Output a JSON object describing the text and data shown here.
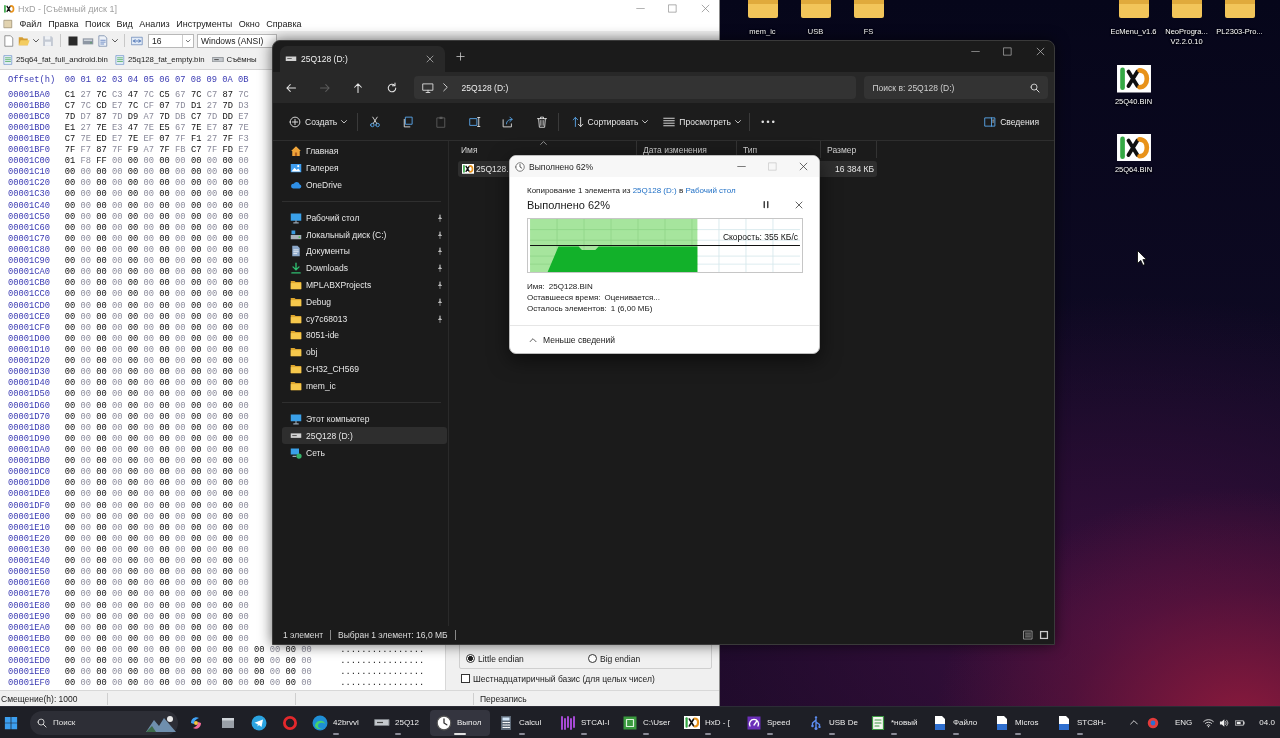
{
  "hxd": {
    "title": "HxD - [Съёмный диск 1]",
    "menu": [
      "Файл",
      "Правка",
      "Поиск",
      "Вид",
      "Анализ",
      "Инструменты",
      "Окно",
      "Справка"
    ],
    "toolbar": {
      "bytes_per_row": "16",
      "encoding": "Windows (ANSI)"
    },
    "tabs": [
      {
        "kind": "file",
        "label": "25q64_fat_full_android.bin"
      },
      {
        "kind": "file",
        "label": "25q128_fat_empty.bin"
      },
      {
        "kind": "drive",
        "label": "Съёмны"
      }
    ],
    "hex_header": {
      "offset_label": "Offset(h)",
      "columns": [
        "00",
        "01",
        "02",
        "03",
        "04",
        "05",
        "06",
        "07",
        "08",
        "09",
        "0A",
        "0B"
      ]
    },
    "hex_rows": [
      {
        "offset": "00001BA0",
        "bytes": [
          "C1",
          "27",
          "7C",
          "C3",
          "47",
          "7C",
          "C5",
          "67",
          "7C",
          "C7",
          "87",
          "7C"
        ]
      },
      {
        "offset": "00001BB0",
        "bytes": [
          "C7",
          "7C",
          "CD",
          "E7",
          "7C",
          "CF",
          "07",
          "7D",
          "D1",
          "27",
          "7D",
          "D3"
        ]
      },
      {
        "offset": "00001BC0",
        "bytes": [
          "7D",
          "D7",
          "87",
          "7D",
          "D9",
          "A7",
          "7D",
          "DB",
          "C7",
          "7D",
          "DD",
          "E7"
        ]
      },
      {
        "offset": "00001BD0",
        "bytes": [
          "E1",
          "27",
          "7E",
          "E3",
          "47",
          "7E",
          "E5",
          "67",
          "7E",
          "E7",
          "87",
          "7E"
        ]
      },
      {
        "offset": "00001BE0",
        "bytes": [
          "C7",
          "7E",
          "ED",
          "E7",
          "7E",
          "EF",
          "07",
          "7F",
          "F1",
          "27",
          "7F",
          "F3"
        ]
      },
      {
        "offset": "00001BF0",
        "bytes": [
          "7F",
          "F7",
          "87",
          "7F",
          "F9",
          "A7",
          "7F",
          "FB",
          "C7",
          "7F",
          "FD",
          "E7"
        ]
      },
      {
        "offset": "00001C00",
        "bytes": [
          "01",
          "F8",
          "FF",
          "00",
          "00",
          "00",
          "00",
          "00",
          "00",
          "00",
          "00",
          "00"
        ]
      },
      {
        "offset": "00001C10",
        "bytes": [
          "00",
          "00",
          "00",
          "00",
          "00",
          "00",
          "00",
          "00",
          "00",
          "00",
          "00",
          "00"
        ]
      },
      {
        "offset": "00001C20",
        "bytes": [
          "00",
          "00",
          "00",
          "00",
          "00",
          "00",
          "00",
          "00",
          "00",
          "00",
          "00",
          "00"
        ]
      },
      {
        "offset": "00001C30",
        "bytes": [
          "00",
          "00",
          "00",
          "00",
          "00",
          "00",
          "00",
          "00",
          "00",
          "00",
          "00",
          "00"
        ]
      },
      {
        "offset": "00001C40",
        "bytes": [
          "00",
          "00",
          "00",
          "00",
          "00",
          "00",
          "00",
          "00",
          "00",
          "00",
          "00",
          "00"
        ]
      },
      {
        "offset": "00001C50",
        "bytes": [
          "00",
          "00",
          "00",
          "00",
          "00",
          "00",
          "00",
          "00",
          "00",
          "00",
          "00",
          "00"
        ]
      },
      {
        "offset": "00001C60",
        "bytes": [
          "00",
          "00",
          "00",
          "00",
          "00",
          "00",
          "00",
          "00",
          "00",
          "00",
          "00",
          "00"
        ]
      },
      {
        "offset": "00001C70",
        "bytes": [
          "00",
          "00",
          "00",
          "00",
          "00",
          "00",
          "00",
          "00",
          "00",
          "00",
          "00",
          "00"
        ]
      },
      {
        "offset": "00001C80",
        "bytes": [
          "00",
          "00",
          "00",
          "00",
          "00",
          "00",
          "00",
          "00",
          "00",
          "00",
          "00",
          "00"
        ]
      },
      {
        "offset": "00001C90",
        "bytes": [
          "00",
          "00",
          "00",
          "00",
          "00",
          "00",
          "00",
          "00",
          "00",
          "00",
          "00",
          "00"
        ]
      },
      {
        "offset": "00001CA0",
        "bytes": [
          "00",
          "00",
          "00",
          "00",
          "00",
          "00",
          "00",
          "00",
          "00",
          "00",
          "00",
          "00"
        ]
      },
      {
        "offset": "00001CB0",
        "bytes": [
          "00",
          "00",
          "00",
          "00",
          "00",
          "00",
          "00",
          "00",
          "00",
          "00",
          "00",
          "00"
        ]
      },
      {
        "offset": "00001CC0",
        "bytes": [
          "00",
          "00",
          "00",
          "00",
          "00",
          "00",
          "00",
          "00",
          "00",
          "00",
          "00",
          "00"
        ]
      },
      {
        "offset": "00001CD0",
        "bytes": [
          "00",
          "00",
          "00",
          "00",
          "00",
          "00",
          "00",
          "00",
          "00",
          "00",
          "00",
          "00"
        ]
      },
      {
        "offset": "00001CE0",
        "bytes": [
          "00",
          "00",
          "00",
          "00",
          "00",
          "00",
          "00",
          "00",
          "00",
          "00",
          "00",
          "00"
        ]
      },
      {
        "offset": "00001CF0",
        "bytes": [
          "00",
          "00",
          "00",
          "00",
          "00",
          "00",
          "00",
          "00",
          "00",
          "00",
          "00",
          "00"
        ]
      },
      {
        "offset": "00001D00",
        "bytes": [
          "00",
          "00",
          "00",
          "00",
          "00",
          "00",
          "00",
          "00",
          "00",
          "00",
          "00",
          "00"
        ]
      },
      {
        "offset": "00001D10",
        "bytes": [
          "00",
          "00",
          "00",
          "00",
          "00",
          "00",
          "00",
          "00",
          "00",
          "00",
          "00",
          "00"
        ]
      },
      {
        "offset": "00001D20",
        "bytes": [
          "00",
          "00",
          "00",
          "00",
          "00",
          "00",
          "00",
          "00",
          "00",
          "00",
          "00",
          "00"
        ]
      },
      {
        "offset": "00001D30",
        "bytes": [
          "00",
          "00",
          "00",
          "00",
          "00",
          "00",
          "00",
          "00",
          "00",
          "00",
          "00",
          "00"
        ]
      },
      {
        "offset": "00001D40",
        "bytes": [
          "00",
          "00",
          "00",
          "00",
          "00",
          "00",
          "00",
          "00",
          "00",
          "00",
          "00",
          "00"
        ]
      },
      {
        "offset": "00001D50",
        "bytes": [
          "00",
          "00",
          "00",
          "00",
          "00",
          "00",
          "00",
          "00",
          "00",
          "00",
          "00",
          "00"
        ]
      },
      {
        "offset": "00001D60",
        "bytes": [
          "00",
          "00",
          "00",
          "00",
          "00",
          "00",
          "00",
          "00",
          "00",
          "00",
          "00",
          "00"
        ]
      },
      {
        "offset": "00001D70",
        "bytes": [
          "00",
          "00",
          "00",
          "00",
          "00",
          "00",
          "00",
          "00",
          "00",
          "00",
          "00",
          "00"
        ]
      },
      {
        "offset": "00001D80",
        "bytes": [
          "00",
          "00",
          "00",
          "00",
          "00",
          "00",
          "00",
          "00",
          "00",
          "00",
          "00",
          "00"
        ]
      },
      {
        "offset": "00001D90",
        "bytes": [
          "00",
          "00",
          "00",
          "00",
          "00",
          "00",
          "00",
          "00",
          "00",
          "00",
          "00",
          "00"
        ]
      },
      {
        "offset": "00001DA0",
        "bytes": [
          "00",
          "00",
          "00",
          "00",
          "00",
          "00",
          "00",
          "00",
          "00",
          "00",
          "00",
          "00"
        ]
      },
      {
        "offset": "00001DB0",
        "bytes": [
          "00",
          "00",
          "00",
          "00",
          "00",
          "00",
          "00",
          "00",
          "00",
          "00",
          "00",
          "00"
        ]
      },
      {
        "offset": "00001DC0",
        "bytes": [
          "00",
          "00",
          "00",
          "00",
          "00",
          "00",
          "00",
          "00",
          "00",
          "00",
          "00",
          "00"
        ]
      },
      {
        "offset": "00001DD0",
        "bytes": [
          "00",
          "00",
          "00",
          "00",
          "00",
          "00",
          "00",
          "00",
          "00",
          "00",
          "00",
          "00"
        ]
      },
      {
        "offset": "00001DE0",
        "bytes": [
          "00",
          "00",
          "00",
          "00",
          "00",
          "00",
          "00",
          "00",
          "00",
          "00",
          "00",
          "00"
        ]
      },
      {
        "offset": "00001DF0",
        "bytes": [
          "00",
          "00",
          "00",
          "00",
          "00",
          "00",
          "00",
          "00",
          "00",
          "00",
          "00",
          "00"
        ]
      },
      {
        "offset": "00001E00",
        "bytes": [
          "00",
          "00",
          "00",
          "00",
          "00",
          "00",
          "00",
          "00",
          "00",
          "00",
          "00",
          "00"
        ]
      },
      {
        "offset": "00001E10",
        "bytes": [
          "00",
          "00",
          "00",
          "00",
          "00",
          "00",
          "00",
          "00",
          "00",
          "00",
          "00",
          "00"
        ]
      },
      {
        "offset": "00001E20",
        "bytes": [
          "00",
          "00",
          "00",
          "00",
          "00",
          "00",
          "00",
          "00",
          "00",
          "00",
          "00",
          "00"
        ]
      },
      {
        "offset": "00001E30",
        "bytes": [
          "00",
          "00",
          "00",
          "00",
          "00",
          "00",
          "00",
          "00",
          "00",
          "00",
          "00",
          "00"
        ]
      },
      {
        "offset": "00001E40",
        "bytes": [
          "00",
          "00",
          "00",
          "00",
          "00",
          "00",
          "00",
          "00",
          "00",
          "00",
          "00",
          "00"
        ]
      },
      {
        "offset": "00001E50",
        "bytes": [
          "00",
          "00",
          "00",
          "00",
          "00",
          "00",
          "00",
          "00",
          "00",
          "00",
          "00",
          "00"
        ]
      },
      {
        "offset": "00001E60",
        "bytes": [
          "00",
          "00",
          "00",
          "00",
          "00",
          "00",
          "00",
          "00",
          "00",
          "00",
          "00",
          "00"
        ]
      },
      {
        "offset": "00001E70",
        "bytes": [
          "00",
          "00",
          "00",
          "00",
          "00",
          "00",
          "00",
          "00",
          "00",
          "00",
          "00",
          "00"
        ]
      },
      {
        "offset": "00001E80",
        "bytes": [
          "00",
          "00",
          "00",
          "00",
          "00",
          "00",
          "00",
          "00",
          "00",
          "00",
          "00",
          "00"
        ]
      },
      {
        "offset": "00001E90",
        "bytes": [
          "00",
          "00",
          "00",
          "00",
          "00",
          "00",
          "00",
          "00",
          "00",
          "00",
          "00",
          "00"
        ]
      },
      {
        "offset": "00001EA0",
        "bytes": [
          "00",
          "00",
          "00",
          "00",
          "00",
          "00",
          "00",
          "00",
          "00",
          "00",
          "00",
          "00"
        ]
      },
      {
        "offset": "00001EB0",
        "bytes": [
          "00",
          "00",
          "00",
          "00",
          "00",
          "00",
          "00",
          "00",
          "00",
          "00",
          "00",
          "00"
        ]
      },
      {
        "offset": "00001EC0",
        "bytes": [
          "00",
          "00",
          "00",
          "00",
          "00",
          "00",
          "00",
          "00",
          "00",
          "00",
          "00",
          "00",
          "00",
          "00",
          "00",
          "00"
        ],
        "ascii": "................"
      },
      {
        "offset": "00001ED0",
        "bytes": [
          "00",
          "00",
          "00",
          "00",
          "00",
          "00",
          "00",
          "00",
          "00",
          "00",
          "00",
          "00",
          "00",
          "00",
          "00",
          "00"
        ],
        "ascii": "................"
      },
      {
        "offset": "00001EE0",
        "bytes": [
          "00",
          "00",
          "00",
          "00",
          "00",
          "00",
          "00",
          "00",
          "00",
          "00",
          "00",
          "00",
          "00",
          "00",
          "00",
          "00"
        ],
        "ascii": "................"
      },
      {
        "offset": "00001EF0",
        "bytes": [
          "00",
          "00",
          "00",
          "00",
          "00",
          "00",
          "00",
          "00",
          "00",
          "00",
          "00",
          "00",
          "00",
          "00",
          "00",
          "00"
        ],
        "ascii": "................"
      }
    ],
    "inspector": {
      "endian": [
        {
          "label": "Little endian",
          "selected": true
        },
        {
          "label": "Big endian",
          "selected": false
        }
      ],
      "hex_basis": {
        "label": "Шестнадцатиричный базис (для целых чисел)",
        "checked": false
      }
    },
    "status_bar": {
      "offset": "Смещение(h): 1000",
      "mode": "Перезапись"
    }
  },
  "explorer": {
    "tab": {
      "label": "25Q128 (D:)"
    },
    "nav": [
      {
        "kind": "back",
        "disabled": false
      },
      {
        "kind": "forward",
        "disabled": true
      },
      {
        "kind": "up",
        "disabled": false
      },
      {
        "kind": "refresh",
        "disabled": false
      }
    ],
    "address": {
      "path": "25Q128 (D:)"
    },
    "search": {
      "placeholder": "Поиск в: 25Q128 (D:)"
    },
    "toolbar": [
      {
        "items": [
          {
            "kind": "new",
            "label": "Создать",
            "dropdown": true,
            "disabled": false
          }
        ]
      },
      {
        "items": [
          {
            "kind": "cut",
            "dropdown": false,
            "disabled": false
          },
          {
            "kind": "copy",
            "dropdown": false,
            "disabled": false
          },
          {
            "kind": "paste",
            "dropdown": false,
            "disabled": true
          },
          {
            "kind": "rename",
            "dropdown": false,
            "disabled": false
          },
          {
            "kind": "share",
            "dropdown": false,
            "disabled": false
          },
          {
            "kind": "delete",
            "dropdown": false,
            "disabled": false
          }
        ]
      },
      {
        "items": [
          {
            "kind": "sort",
            "label": "Сортировать",
            "dropdown": true,
            "disabled": false
          },
          {
            "kind": "view",
            "label": "Просмотреть",
            "dropdown": true,
            "disabled": false
          }
        ]
      },
      {
        "items": [
          {
            "kind": "more",
            "dropdown": false,
            "disabled": false
          }
        ]
      }
    ],
    "details_button": {
      "label": "Сведения"
    },
    "sidebar": [
      {
        "items": [
          {
            "kind": "home",
            "label": "Главная",
            "pinned": false,
            "selected": false
          },
          {
            "kind": "gallery",
            "label": "Галерея",
            "pinned": false,
            "selected": false
          },
          {
            "kind": "onedrive",
            "label": "OneDrive",
            "pinned": false,
            "selected": false
          }
        ]
      },
      {
        "items": [
          {
            "kind": "desktop",
            "label": "Рабочий стол",
            "pinned": true,
            "selected": false
          },
          {
            "kind": "localdisk",
            "label": "Локальный диск (C:)",
            "pinned": true,
            "selected": false
          },
          {
            "kind": "documents",
            "label": "Документы",
            "pinned": true,
            "selected": false
          },
          {
            "kind": "downloads",
            "label": "Downloads",
            "pinned": true,
            "selected": false
          },
          {
            "kind": "folder",
            "label": "MPLABXProjects",
            "pinned": true,
            "selected": false
          },
          {
            "kind": "folder",
            "label": "Debug",
            "pinned": true,
            "selected": false
          },
          {
            "kind": "folder",
            "label": "cy7c68013",
            "pinned": true,
            "selected": false
          },
          {
            "kind": "folder",
            "label": "8051-ide",
            "pinned": false,
            "selected": false
          },
          {
            "kind": "folder",
            "label": "obj",
            "pinned": false,
            "selected": false
          },
          {
            "kind": "folder",
            "label": "CH32_CH569",
            "pinned": false,
            "selected": false
          },
          {
            "kind": "folder",
            "label": "mem_ic",
            "pinned": false,
            "selected": false
          }
        ]
      },
      {
        "items": [
          {
            "kind": "computer",
            "label": "Этот компьютер",
            "pinned": false,
            "selected": false
          },
          {
            "kind": "usbdrive",
            "label": "25Q128 (D:)",
            "pinned": false,
            "selected": true
          },
          {
            "kind": "network",
            "label": "Сеть",
            "pinned": false,
            "selected": false
          }
        ]
      }
    ],
    "columns": [
      {
        "label": "Имя",
        "sorted": true
      },
      {
        "label": "Дата изменения",
        "sorted": false
      },
      {
        "label": "Тип",
        "sorted": false
      },
      {
        "label": "Размер",
        "sorted": false
      }
    ],
    "files": [
      {
        "name": "25Q128.",
        "size": "16 384 КБ",
        "selected": true
      }
    ],
    "status": [
      "1 элемент",
      "Выбран 1 элемент: 16,0 МБ"
    ]
  },
  "copy_dialog": {
    "title": "Выполнено 62%",
    "window_controls": [
      {
        "kind": "minimize",
        "disabled": false
      },
      {
        "kind": "maximize",
        "disabled": true
      },
      {
        "kind": "close",
        "disabled": false
      }
    ],
    "summary": {
      "prefix": "Копирование 1 элемента из",
      "source": "25Q128 (D:)",
      "middle": "в",
      "destination": "Рабочий стол"
    },
    "heading": "Выполнено 62%",
    "progress": {
      "level": 0.62,
      "speed": "Скорость: 355 КБ/с"
    },
    "details": [
      {
        "label": "Имя:",
        "value": "25Q128.BIN"
      },
      {
        "label": "Оставшееся время:",
        "value": "Оценивается..."
      },
      {
        "label": "Осталось элементов:",
        "value": "1 (6,00 МБ)"
      }
    ],
    "toggle": "Меньше сведений"
  },
  "desktop": {
    "top_left": [
      {
        "label": "mem_ic"
      },
      {
        "label": "USB"
      },
      {
        "label": "FS"
      }
    ],
    "top_right": [
      {
        "label": "EcMenu_v1.6"
      },
      {
        "label": "NeoProgra... V2.2.0.10"
      },
      {
        "label": "PL2303-Pro..."
      }
    ],
    "files": [
      {
        "label": "25Q40.BIN"
      },
      {
        "label": "25Q64.BIN"
      }
    ]
  },
  "taskbar": {
    "search": {
      "placeholder": "Поиск"
    },
    "pinned": [
      {
        "kind": "swirl"
      },
      {
        "kind": "window"
      },
      {
        "kind": "plane"
      },
      {
        "kind": "ring"
      }
    ],
    "apps": [
      {
        "kind": "browser",
        "label": "42brvvl",
        "selected": false
      },
      {
        "kind": "drive",
        "label": "25Q12",
        "selected": false
      },
      {
        "kind": "clock",
        "label": "Выпол",
        "selected": true
      },
      {
        "kind": "calculator",
        "label": "Calcul",
        "selected": false
      },
      {
        "kind": "stripes",
        "label": "STCAI-I",
        "selected": false
      },
      {
        "kind": "tile",
        "label": "C:\\User",
        "selected": false
      },
      {
        "kind": "hexfile",
        "label": "HxD - [",
        "selected": false
      },
      {
        "kind": "gauge",
        "label": "Speed",
        "selected": false
      },
      {
        "kind": "usb",
        "label": "USB De",
        "selected": false
      },
      {
        "kind": "notepad",
        "label": "*новый",
        "selected": false
      },
      {
        "kind": "document",
        "label": "Файло",
        "selected": false
      },
      {
        "kind": "document",
        "label": "Micros",
        "selected": false
      },
      {
        "kind": "document",
        "label": "STC8H-",
        "selected": false
      }
    ],
    "tray": {
      "language": "ENG",
      "clock": "04.0"
    }
  }
}
